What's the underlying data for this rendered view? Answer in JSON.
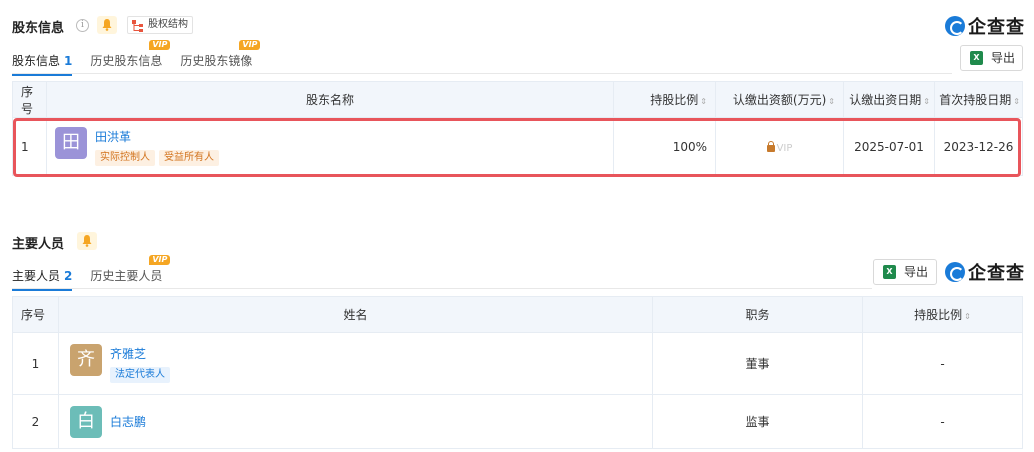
{
  "shareholders": {
    "title": "股东信息",
    "structure_label": "股权结构",
    "tabs": [
      {
        "label": "股东信息",
        "count": "1"
      },
      {
        "label": "历史股东信息",
        "vip": "VIP"
      },
      {
        "label": "历史股东镜像",
        "vip": "VIP"
      }
    ],
    "export_label": "导出",
    "columns": [
      "序号",
      "股东名称",
      "持股比例",
      "认缴出资额(万元)",
      "认缴出资日期",
      "首次持股日期"
    ],
    "rows": [
      {
        "index": "1",
        "avatar_char": "田",
        "name": "田洪革",
        "badges": [
          "实际控制人",
          "受益所有人"
        ],
        "ratio": "100%",
        "capital_vip": "VIP",
        "subscribe_date": "2025-07-01",
        "first_hold_date": "2023-12-26"
      }
    ]
  },
  "personnel": {
    "title": "主要人员",
    "tabs": [
      {
        "label": "主要人员",
        "count": "2"
      },
      {
        "label": "历史主要人员",
        "vip": "VIP"
      }
    ],
    "export_label": "导出",
    "columns": [
      "序号",
      "姓名",
      "职务",
      "持股比例"
    ],
    "rows": [
      {
        "index": "1",
        "avatar_char": "齐",
        "name": "齐雅芝",
        "badge": "法定代表人",
        "position": "董事",
        "ratio": "-"
      },
      {
        "index": "2",
        "avatar_char": "白",
        "name": "白志鹏",
        "position": "监事",
        "ratio": "-"
      }
    ]
  },
  "logo_text": "企查查",
  "colors": {
    "accent": "#1a7bd8",
    "highlight": "#e8555b",
    "avatar_tian": "#9b93d8",
    "avatar_qi": "#c9a36e",
    "avatar_bai": "#6cbdb8"
  }
}
